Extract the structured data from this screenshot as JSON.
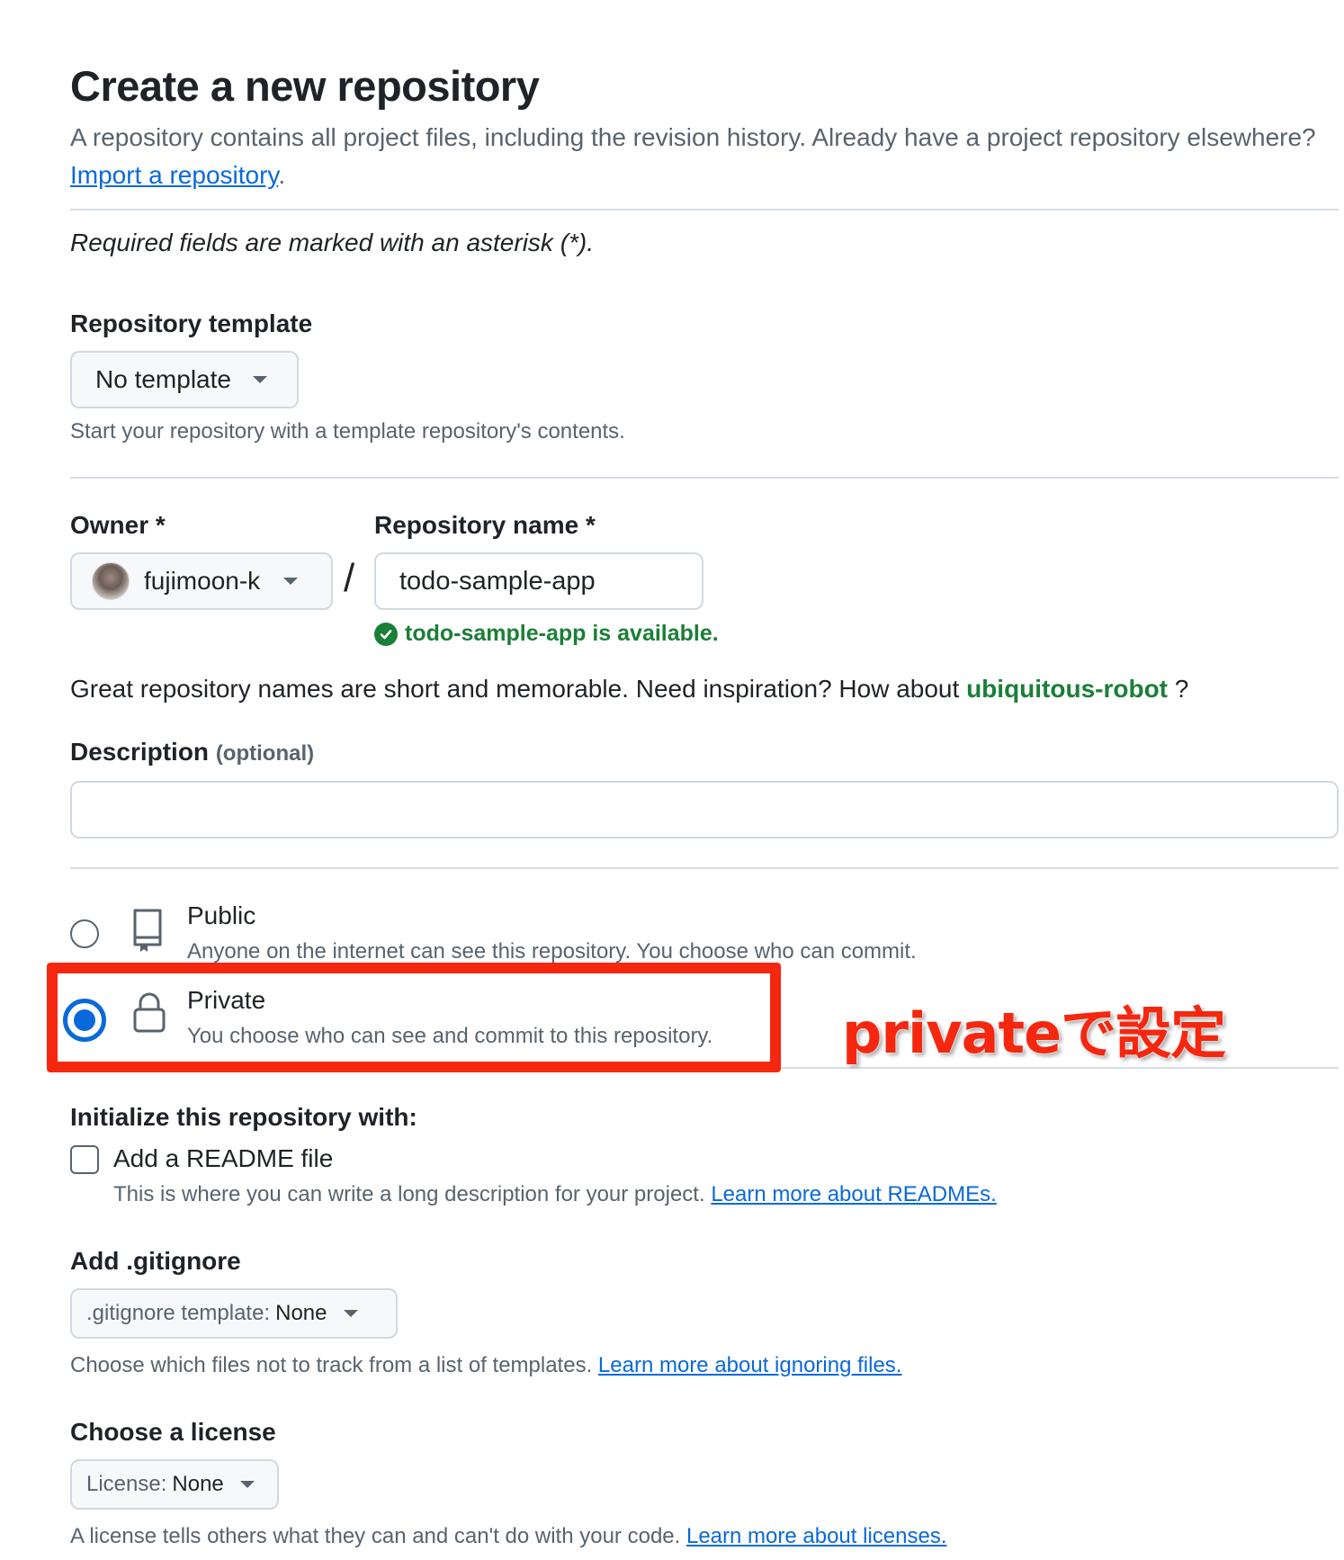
{
  "header": {
    "title": "Create a new repository",
    "subtitle": "A repository contains all project files, including the revision history. Already have a project repository elsewhere?",
    "import_link": "Import a repository",
    "subtitle_end": "."
  },
  "required_note": "Required fields are marked with an asterisk (*).",
  "template": {
    "label": "Repository template",
    "value": "No template",
    "hint": "Start your repository with a template repository's contents."
  },
  "owner": {
    "label": "Owner *",
    "value": "fujimoon-k",
    "separator": "/"
  },
  "repo_name": {
    "label": "Repository name *",
    "value": "todo-sample-app",
    "status": "todo-sample-app is available."
  },
  "inspiration": {
    "text": "Great repository names are short and memorable. Need inspiration? How about",
    "suggestion": "ubiquitous-robot",
    "end": "?"
  },
  "description": {
    "label": "Description",
    "optional": "(optional)",
    "value": ""
  },
  "visibility": {
    "public_title": "Public",
    "public_desc": "Anyone on the internet can see this repository. You choose who can commit.",
    "private_title": "Private",
    "private_desc": "You choose who can see and commit to this repository.",
    "selected": "private"
  },
  "annotation": "privateで設定",
  "initialize": {
    "label": "Initialize this repository with:",
    "readme_label": "Add a README file",
    "readme_hint": "This is where you can write a long description for your project.",
    "readme_link": "Learn more about READMEs."
  },
  "gitignore": {
    "label": "Add .gitignore",
    "prefix": ".gitignore template:",
    "value": "None",
    "hint": "Choose which files not to track from a list of templates.",
    "link": "Learn more about ignoring files."
  },
  "license": {
    "label": "Choose a license",
    "prefix": "License:",
    "value": "None",
    "hint": "A license tells others what they can and can't do with your code.",
    "link": "Learn more about licenses."
  },
  "colors": {
    "accent": "#0969da",
    "success": "#1a7f37",
    "annotation_red": "#f5270f"
  }
}
